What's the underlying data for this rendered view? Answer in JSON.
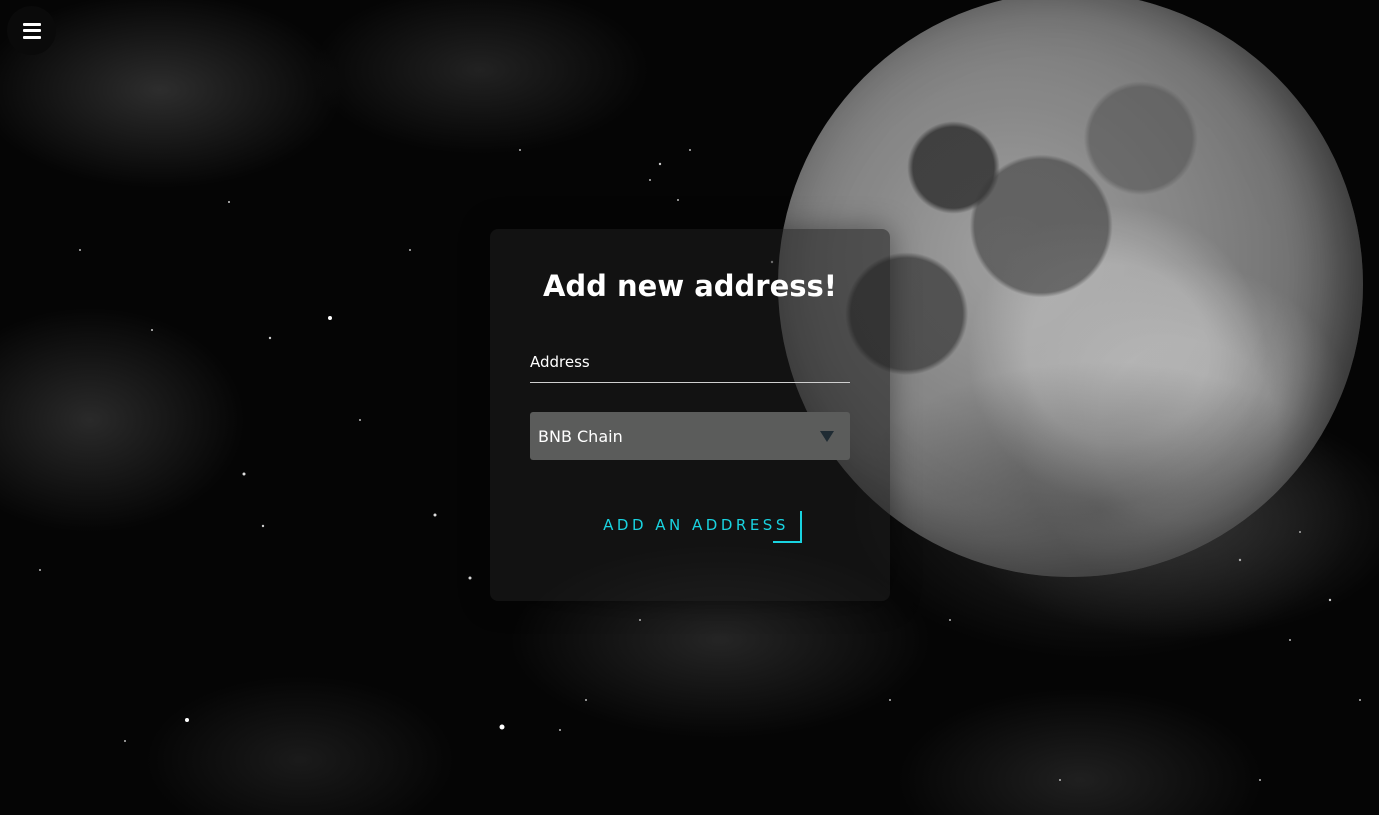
{
  "nav": {
    "menu_icon": "hamburger-menu-icon"
  },
  "form": {
    "title": "Add new address!",
    "address_placeholder": "Address",
    "address_value": "",
    "chain_selected": "BNB Chain",
    "submit_label": "ADD AN ADDRESS"
  },
  "colors": {
    "accent": "#19d3e0",
    "select_bg": "#5b5c5b",
    "card_bg": "#1e1e1e"
  }
}
